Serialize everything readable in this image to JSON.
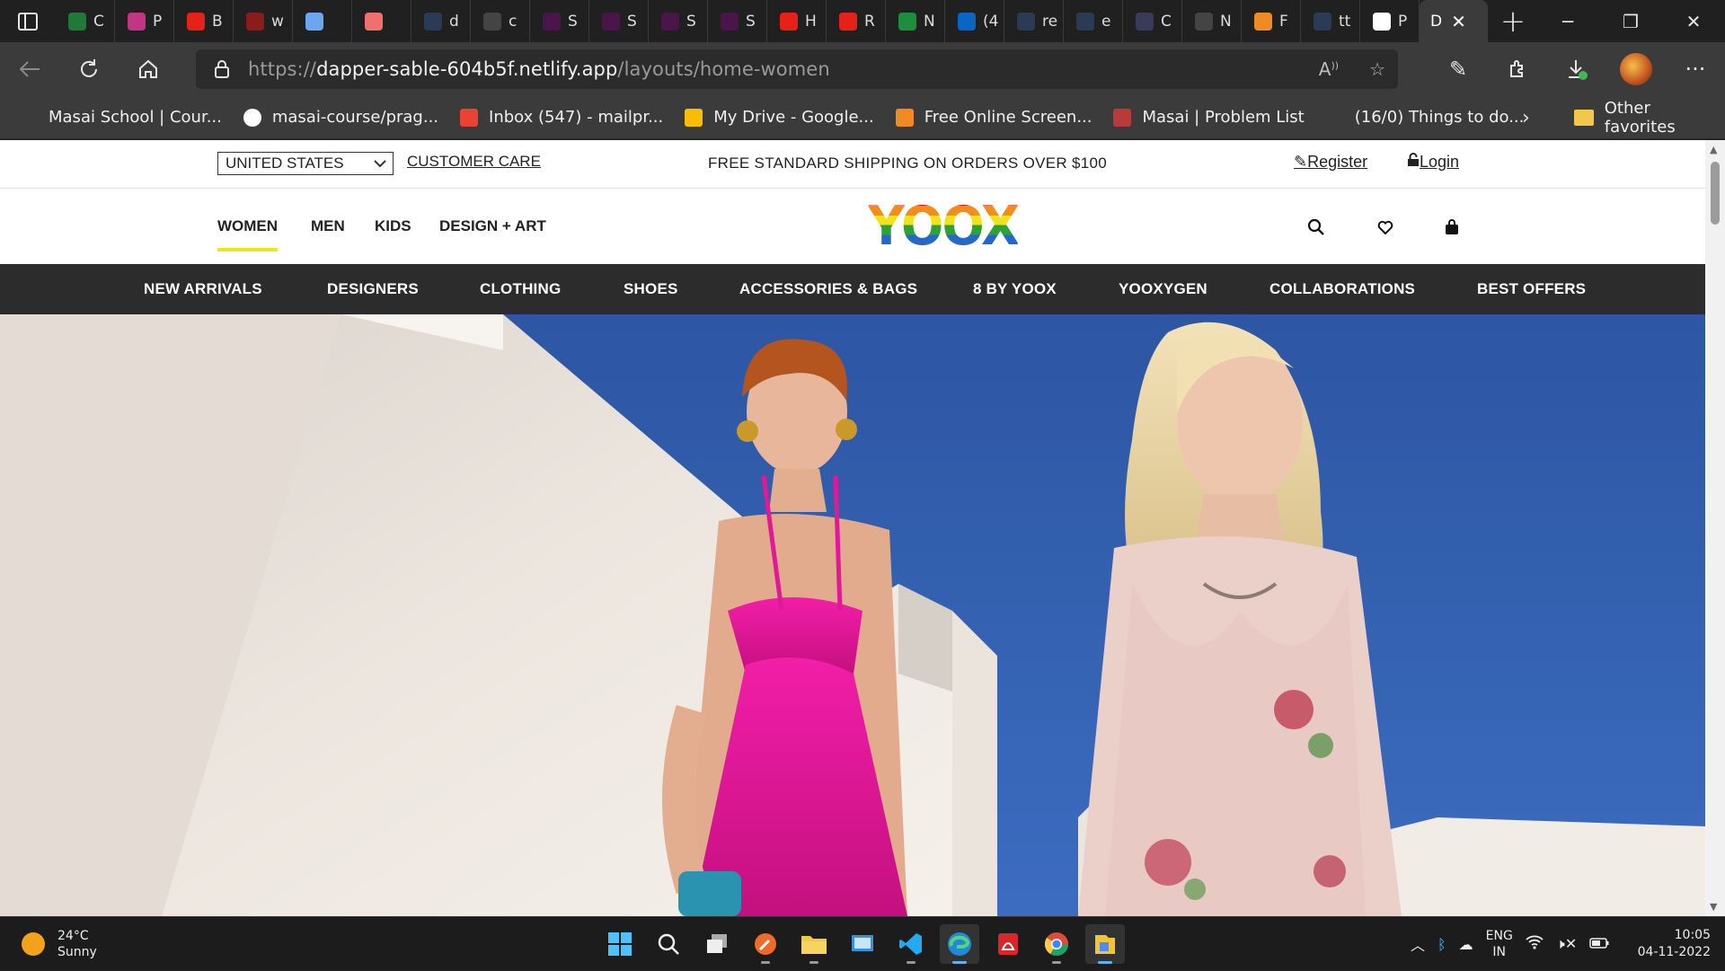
{
  "browser": {
    "tabs": [
      {
        "letter": "C",
        "icon": "mongodb-icon",
        "color": "#1f7a3a"
      },
      {
        "letter": "P",
        "icon": "instagram-icon",
        "color": "#c13584"
      },
      {
        "letter": "B",
        "icon": "youtube-icon",
        "color": "#e62117"
      },
      {
        "letter": "w",
        "icon": "youtube-icon",
        "color": "#8a1c1c"
      },
      {
        "letter": "",
        "icon": "pill-blue-icon",
        "color": "#6aa7f0"
      },
      {
        "letter": "",
        "icon": "pill-red-icon",
        "color": "#f07070"
      },
      {
        "letter": "d",
        "icon": "search-icon",
        "color": "#2b3a55"
      },
      {
        "letter": "c",
        "icon": "page-icon",
        "color": "#444"
      },
      {
        "letter": "S",
        "icon": "slack-icon",
        "color": "#4a154b"
      },
      {
        "letter": "S",
        "icon": "slack-icon",
        "color": "#4a154b"
      },
      {
        "letter": "S",
        "icon": "slack-icon",
        "color": "#4a154b"
      },
      {
        "letter": "S",
        "icon": "slack-icon",
        "color": "#4a154b"
      },
      {
        "letter": "H",
        "icon": "youtube-icon",
        "color": "#e62117"
      },
      {
        "letter": "R",
        "icon": "youtube-icon",
        "color": "#e62117"
      },
      {
        "letter": "N",
        "icon": "sheets-icon",
        "color": "#1e8e3e"
      },
      {
        "letter": "(4",
        "icon": "linkedin-icon",
        "color": "#0a66c2"
      },
      {
        "letter": "re",
        "icon": "search-icon",
        "color": "#2b3a55"
      },
      {
        "letter": "e",
        "icon": "search-icon",
        "color": "#2b3a55"
      },
      {
        "letter": "C",
        "icon": "page-icon",
        "color": "#3a3a5a"
      },
      {
        "letter": "N",
        "icon": "page-icon",
        "color": "#444"
      },
      {
        "letter": "F",
        "icon": "screenshot-icon",
        "color": "#f08a24"
      },
      {
        "letter": "tt",
        "icon": "search-icon",
        "color": "#2b3a55"
      },
      {
        "letter": "P",
        "icon": "p-icon",
        "color": "#ffffff"
      }
    ],
    "active_tab": {
      "letter": "D"
    },
    "url_scheme": "https://",
    "url_host": "dapper-sable-604b5f.netlify.app",
    "url_path": "/layouts/home-women",
    "bookmarks": [
      {
        "label": "Masai School | Cour...",
        "icon": "page-icon",
        "color": "#3b3b3b"
      },
      {
        "label": "masai-course/prag...",
        "icon": "github-icon",
        "color": "#ffffff"
      },
      {
        "label": "Inbox (547) - mailpr...",
        "icon": "gmail-icon",
        "color": "#ea4335"
      },
      {
        "label": "My Drive - Google...",
        "icon": "drive-icon",
        "color": "#fbbc04"
      },
      {
        "label": "Free Online Screen...",
        "icon": "screenshot-icon",
        "color": "#f08a24"
      },
      {
        "label": "Masai | Problem List",
        "icon": "masai-icon",
        "color": "#b83b3b"
      },
      {
        "label": "(16/0) Things to do...",
        "icon": "check-icon",
        "color": "#3b3b3b"
      }
    ],
    "other_favorites": "Other favorites"
  },
  "site": {
    "country": "UNITED STATES",
    "customer_care": "CUSTOMER CARE",
    "shipping": "FREE STANDARD SHIPPING ON ORDERS OVER $100",
    "register": "Register",
    "login": "Login",
    "genders": [
      "WOMEN",
      "MEN",
      "KIDS",
      "DESIGN + ART"
    ],
    "logo": "YOOX",
    "categories": [
      "NEW ARRIVALS",
      "DESIGNERS",
      "CLOTHING",
      "SHOES",
      "ACCESSORIES & BAGS",
      "8 BY YOOX",
      "YOOXYGEN",
      "COLLABORATIONS",
      "BEST OFFERS"
    ]
  },
  "taskbar": {
    "temperature": "24°C",
    "condition": "Sunny",
    "lang_top": "ENG",
    "lang_bottom": "IN",
    "time": "10:05",
    "date": "04-11-2022"
  }
}
